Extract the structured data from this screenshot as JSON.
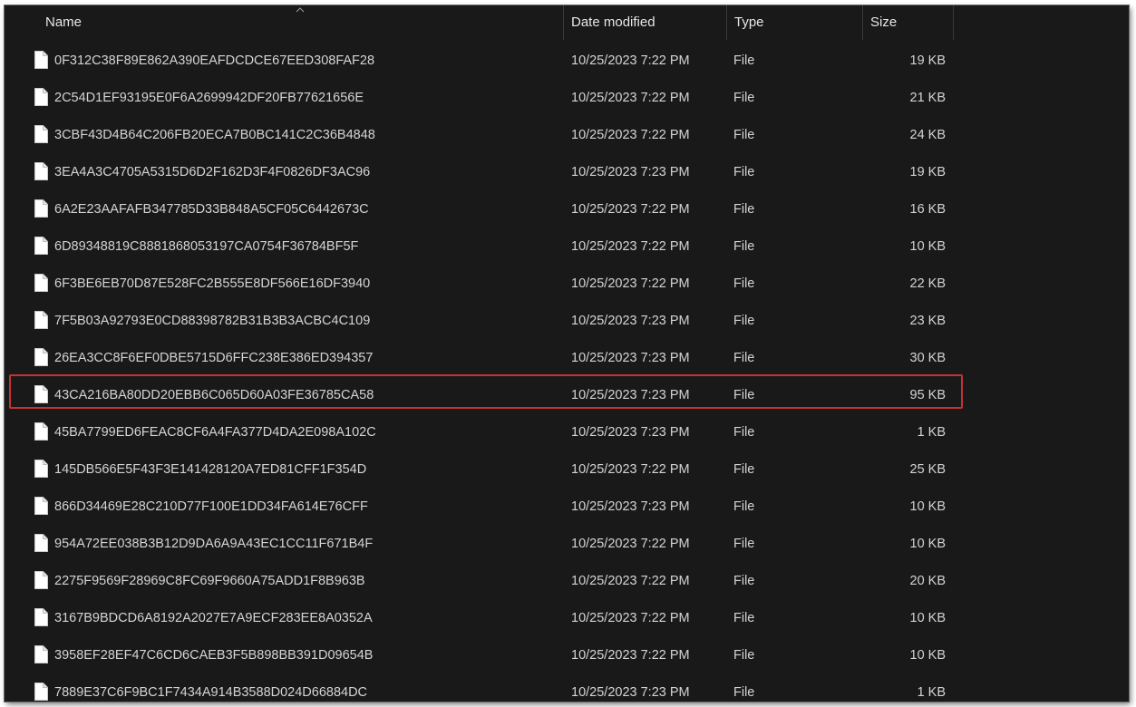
{
  "columns": {
    "name": "Name",
    "date": "Date modified",
    "type": "Type",
    "size": "Size"
  },
  "sort": {
    "column": "name",
    "icon": "sort-ascending-chevron-icon"
  },
  "row_icon": "file-icon",
  "highlight_color": "#c83232",
  "highlighted_row_index": 9,
  "files": [
    {
      "name": "0F312C38F89E862A390EAFDCDCE67EED308FAF28",
      "date": "10/25/2023 7:22 PM",
      "type": "File",
      "size": "19 KB"
    },
    {
      "name": "2C54D1EF93195E0F6A2699942DF20FB77621656E",
      "date": "10/25/2023 7:22 PM",
      "type": "File",
      "size": "21 KB"
    },
    {
      "name": "3CBF43D4B64C206FB20ECA7B0BC141C2C36B4848",
      "date": "10/25/2023 7:22 PM",
      "type": "File",
      "size": "24 KB"
    },
    {
      "name": "3EA4A3C4705A5315D6D2F162D3F4F0826DF3AC96",
      "date": "10/25/2023 7:23 PM",
      "type": "File",
      "size": "19 KB"
    },
    {
      "name": "6A2E23AAFAFB347785D33B848A5CF05C6442673C",
      "date": "10/25/2023 7:22 PM",
      "type": "File",
      "size": "16 KB"
    },
    {
      "name": "6D89348819C8881868053197CA0754F36784BF5F",
      "date": "10/25/2023 7:22 PM",
      "type": "File",
      "size": "10 KB"
    },
    {
      "name": "6F3BE6EB70D87E528FC2B555E8DF566E16DF3940",
      "date": "10/25/2023 7:22 PM",
      "type": "File",
      "size": "22 KB"
    },
    {
      "name": "7F5B03A92793E0CD88398782B31B3B3ACBC4C109",
      "date": "10/25/2023 7:23 PM",
      "type": "File",
      "size": "23 KB"
    },
    {
      "name": "26EA3CC8F6EF0DBE5715D6FFC238E386ED394357",
      "date": "10/25/2023 7:23 PM",
      "type": "File",
      "size": "30 KB"
    },
    {
      "name": "43CA216BA80DD20EBB6C065D60A03FE36785CA58",
      "date": "10/25/2023 7:23 PM",
      "type": "File",
      "size": "95 KB"
    },
    {
      "name": "45BA7799ED6FEAC8CF6A4FA377D4DA2E098A102C",
      "date": "10/25/2023 7:23 PM",
      "type": "File",
      "size": "1 KB"
    },
    {
      "name": "145DB566E5F43F3E141428120A7ED81CFF1F354D",
      "date": "10/25/2023 7:22 PM",
      "type": "File",
      "size": "25 KB"
    },
    {
      "name": "866D34469E28C210D77F100E1DD34FA614E76CFF",
      "date": "10/25/2023 7:23 PM",
      "type": "File",
      "size": "10 KB"
    },
    {
      "name": "954A72EE038B3B12D9DA6A9A43EC1CC11F671B4F",
      "date": "10/25/2023 7:22 PM",
      "type": "File",
      "size": "10 KB"
    },
    {
      "name": "2275F9569F28969C8FC69F9660A75ADD1F8B963B",
      "date": "10/25/2023 7:22 PM",
      "type": "File",
      "size": "20 KB"
    },
    {
      "name": "3167B9BDCD6A8192A2027E7A9ECF283EE8A0352A",
      "date": "10/25/2023 7:22 PM",
      "type": "File",
      "size": "10 KB"
    },
    {
      "name": "3958EF28EF47C6CD6CAEB3F5B898BB391D09654B",
      "date": "10/25/2023 7:22 PM",
      "type": "File",
      "size": "10 KB"
    },
    {
      "name": "7889E37C6F9BC1F7434A914B3588D024D66884DC",
      "date": "10/25/2023 7:23 PM",
      "type": "File",
      "size": "1 KB"
    }
  ]
}
